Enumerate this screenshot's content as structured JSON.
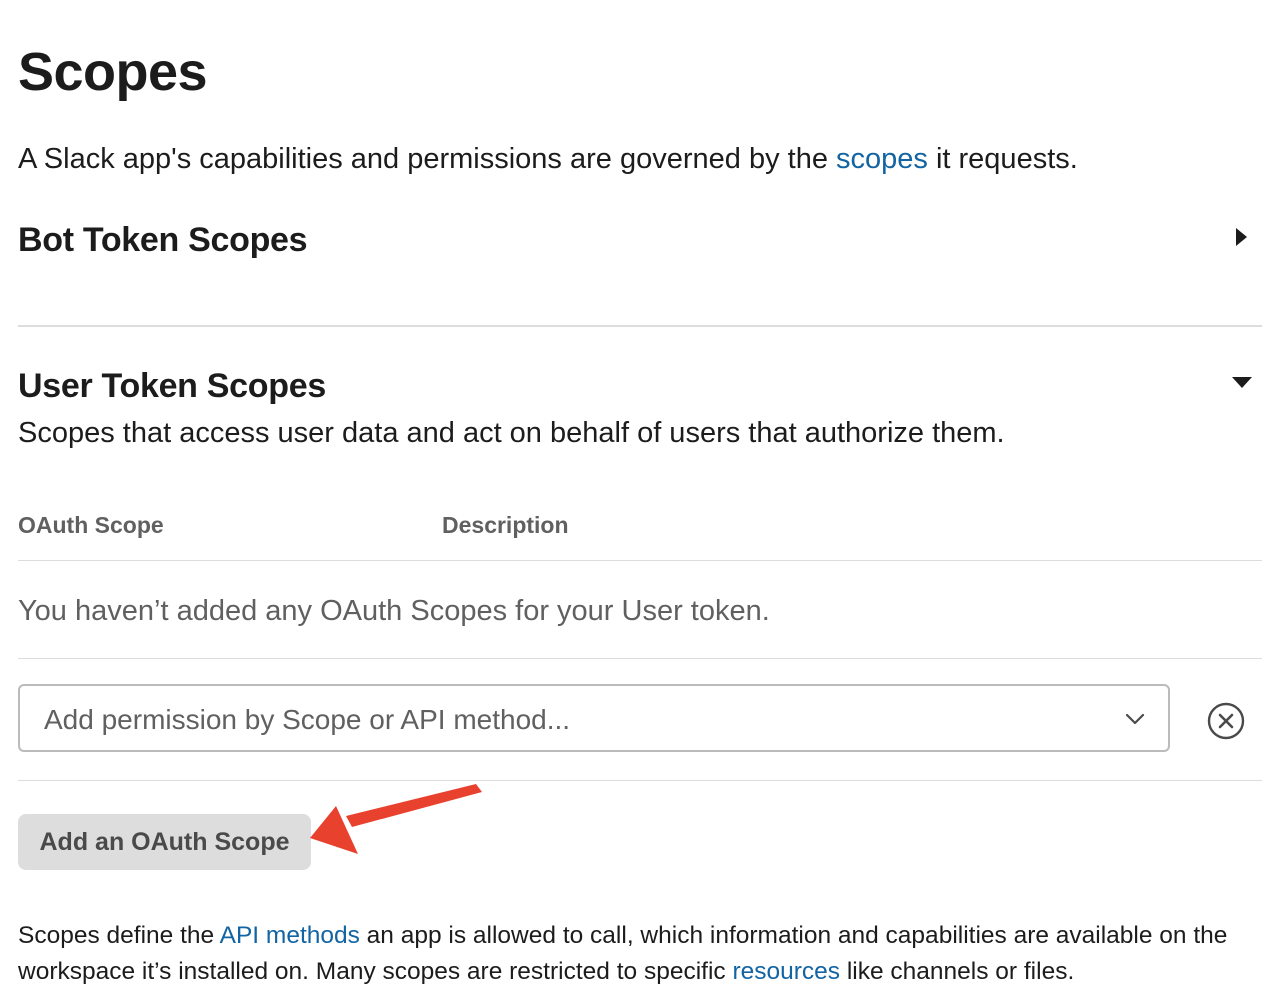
{
  "page": {
    "title": "Scopes",
    "intro_before": "A Slack app's capabilities and permissions are governed by the ",
    "intro_link": "scopes",
    "intro_after": " it requests."
  },
  "bot_section": {
    "heading": "Bot Token Scopes",
    "collapsed": true
  },
  "user_section": {
    "heading": "User Token Scopes",
    "description": "Scopes that access user data and act on behalf of users that authorize them.",
    "table": {
      "headers": [
        "OAuth Scope",
        "Description"
      ],
      "empty_message": "You haven’t added any OAuth Scopes for your User token."
    },
    "select": {
      "placeholder": "Add permission by Scope or API method..."
    },
    "add_button": "Add an OAuth Scope"
  },
  "footer": {
    "part1": "Scopes define the ",
    "link1": "API methods",
    "part2": " an app is allowed to call, which information and capabilities are available on the workspace it’s installed on. Many scopes are restricted to specific ",
    "link2": "resources",
    "part3": " like channels or files."
  },
  "colors": {
    "link": "#1264a3",
    "annotation_arrow": "#e8412e"
  },
  "icons": {
    "bot_toggle": "caret-right-icon",
    "user_toggle": "caret-down-icon",
    "select_dropdown": "chevron-down-icon",
    "clear": "close-circle-icon",
    "annotation": "arrow-annotation-icon"
  }
}
